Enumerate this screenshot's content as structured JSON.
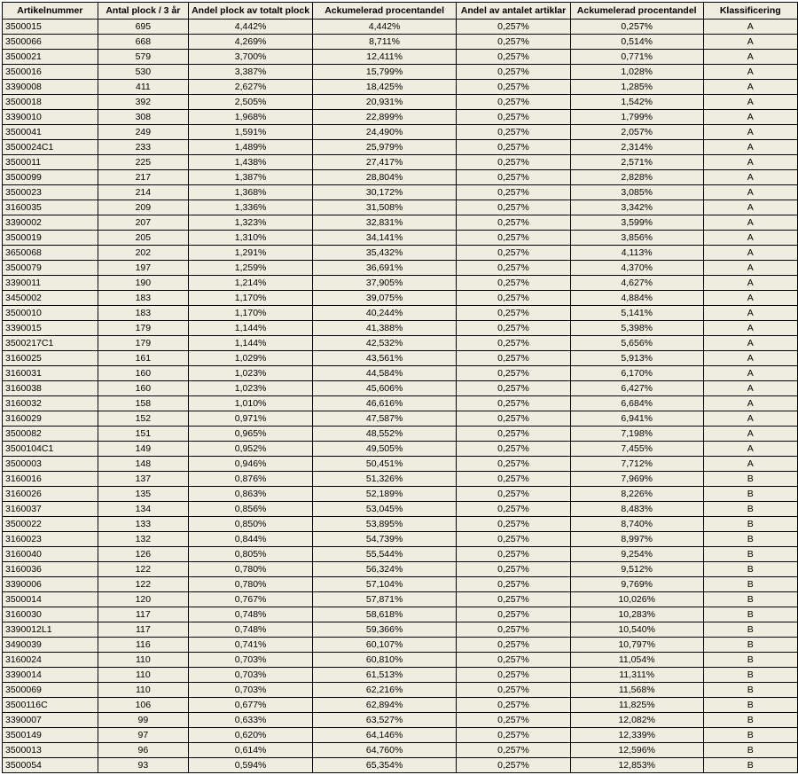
{
  "headers": [
    "Artikelnummer",
    "Antal plock / 3 år",
    "Andel plock av totalt plock",
    "Ackumelerad procentandel",
    "Andel av antalet artiklar",
    "Ackumelerad procentandel",
    "Klassificering"
  ],
  "rows": [
    [
      "3500015",
      "695",
      "4,442%",
      "4,442%",
      "0,257%",
      "0,257%",
      "A"
    ],
    [
      "3500066",
      "668",
      "4,269%",
      "8,711%",
      "0,257%",
      "0,514%",
      "A"
    ],
    [
      "3500021",
      "579",
      "3,700%",
      "12,411%",
      "0,257%",
      "0,771%",
      "A"
    ],
    [
      "3500016",
      "530",
      "3,387%",
      "15,799%",
      "0,257%",
      "1,028%",
      "A"
    ],
    [
      "3390008",
      "411",
      "2,627%",
      "18,425%",
      "0,257%",
      "1,285%",
      "A"
    ],
    [
      "3500018",
      "392",
      "2,505%",
      "20,931%",
      "0,257%",
      "1,542%",
      "A"
    ],
    [
      "3390010",
      "308",
      "1,968%",
      "22,899%",
      "0,257%",
      "1,799%",
      "A"
    ],
    [
      "3500041",
      "249",
      "1,591%",
      "24,490%",
      "0,257%",
      "2,057%",
      "A"
    ],
    [
      "3500024C1",
      "233",
      "1,489%",
      "25,979%",
      "0,257%",
      "2,314%",
      "A"
    ],
    [
      "3500011",
      "225",
      "1,438%",
      "27,417%",
      "0,257%",
      "2,571%",
      "A"
    ],
    [
      "3500099",
      "217",
      "1,387%",
      "28,804%",
      "0,257%",
      "2,828%",
      "A"
    ],
    [
      "3500023",
      "214",
      "1,368%",
      "30,172%",
      "0,257%",
      "3,085%",
      "A"
    ],
    [
      "3160035",
      "209",
      "1,336%",
      "31,508%",
      "0,257%",
      "3,342%",
      "A"
    ],
    [
      "3390002",
      "207",
      "1,323%",
      "32,831%",
      "0,257%",
      "3,599%",
      "A"
    ],
    [
      "3500019",
      "205",
      "1,310%",
      "34,141%",
      "0,257%",
      "3,856%",
      "A"
    ],
    [
      "3650068",
      "202",
      "1,291%",
      "35,432%",
      "0,257%",
      "4,113%",
      "A"
    ],
    [
      "3500079",
      "197",
      "1,259%",
      "36,691%",
      "0,257%",
      "4,370%",
      "A"
    ],
    [
      "3390011",
      "190",
      "1,214%",
      "37,905%",
      "0,257%",
      "4,627%",
      "A"
    ],
    [
      "3450002",
      "183",
      "1,170%",
      "39,075%",
      "0,257%",
      "4,884%",
      "A"
    ],
    [
      "3500010",
      "183",
      "1,170%",
      "40,244%",
      "0,257%",
      "5,141%",
      "A"
    ],
    [
      "3390015",
      "179",
      "1,144%",
      "41,388%",
      "0,257%",
      "5,398%",
      "A"
    ],
    [
      "3500217C1",
      "179",
      "1,144%",
      "42,532%",
      "0,257%",
      "5,656%",
      "A"
    ],
    [
      "3160025",
      "161",
      "1,029%",
      "43,561%",
      "0,257%",
      "5,913%",
      "A"
    ],
    [
      "3160031",
      "160",
      "1,023%",
      "44,584%",
      "0,257%",
      "6,170%",
      "A"
    ],
    [
      "3160038",
      "160",
      "1,023%",
      "45,606%",
      "0,257%",
      "6,427%",
      "A"
    ],
    [
      "3160032",
      "158",
      "1,010%",
      "46,616%",
      "0,257%",
      "6,684%",
      "A"
    ],
    [
      "3160029",
      "152",
      "0,971%",
      "47,587%",
      "0,257%",
      "6,941%",
      "A"
    ],
    [
      "3500082",
      "151",
      "0,965%",
      "48,552%",
      "0,257%",
      "7,198%",
      "A"
    ],
    [
      "3500104C1",
      "149",
      "0,952%",
      "49,505%",
      "0,257%",
      "7,455%",
      "A"
    ],
    [
      "3500003",
      "148",
      "0,946%",
      "50,451%",
      "0,257%",
      "7,712%",
      "A"
    ],
    [
      "3160016",
      "137",
      "0,876%",
      "51,326%",
      "0,257%",
      "7,969%",
      "B"
    ],
    [
      "3160026",
      "135",
      "0,863%",
      "52,189%",
      "0,257%",
      "8,226%",
      "B"
    ],
    [
      "3160037",
      "134",
      "0,856%",
      "53,045%",
      "0,257%",
      "8,483%",
      "B"
    ],
    [
      "3500022",
      "133",
      "0,850%",
      "53,895%",
      "0,257%",
      "8,740%",
      "B"
    ],
    [
      "3160023",
      "132",
      "0,844%",
      "54,739%",
      "0,257%",
      "8,997%",
      "B"
    ],
    [
      "3160040",
      "126",
      "0,805%",
      "55,544%",
      "0,257%",
      "9,254%",
      "B"
    ],
    [
      "3160036",
      "122",
      "0,780%",
      "56,324%",
      "0,257%",
      "9,512%",
      "B"
    ],
    [
      "3390006",
      "122",
      "0,780%",
      "57,104%",
      "0,257%",
      "9,769%",
      "B"
    ],
    [
      "3500014",
      "120",
      "0,767%",
      "57,871%",
      "0,257%",
      "10,026%",
      "B"
    ],
    [
      "3160030",
      "117",
      "0,748%",
      "58,618%",
      "0,257%",
      "10,283%",
      "B"
    ],
    [
      "3390012L1",
      "117",
      "0,748%",
      "59,366%",
      "0,257%",
      "10,540%",
      "B"
    ],
    [
      "3490039",
      "116",
      "0,741%",
      "60,107%",
      "0,257%",
      "10,797%",
      "B"
    ],
    [
      "3160024",
      "110",
      "0,703%",
      "60,810%",
      "0,257%",
      "11,054%",
      "B"
    ],
    [
      "3390014",
      "110",
      "0,703%",
      "61,513%",
      "0,257%",
      "11,311%",
      "B"
    ],
    [
      "3500069",
      "110",
      "0,703%",
      "62,216%",
      "0,257%",
      "11,568%",
      "B"
    ],
    [
      "3500116C",
      "106",
      "0,677%",
      "62,894%",
      "0,257%",
      "11,825%",
      "B"
    ],
    [
      "3390007",
      "99",
      "0,633%",
      "63,527%",
      "0,257%",
      "12,082%",
      "B"
    ],
    [
      "3500149",
      "97",
      "0,620%",
      "64,146%",
      "0,257%",
      "12,339%",
      "B"
    ],
    [
      "3500013",
      "96",
      "0,614%",
      "64,760%",
      "0,257%",
      "12,596%",
      "B"
    ],
    [
      "3500054",
      "93",
      "0,594%",
      "65,354%",
      "0,257%",
      "12,853%",
      "B"
    ]
  ]
}
